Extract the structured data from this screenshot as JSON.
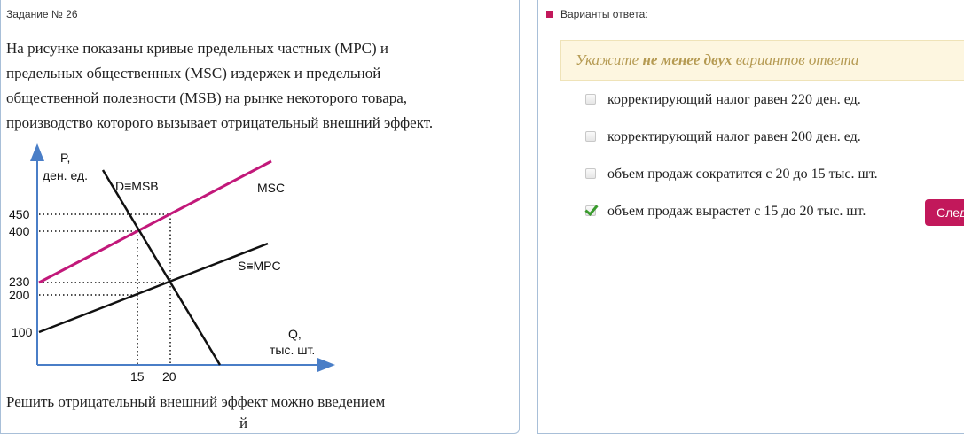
{
  "task": {
    "title": "Задание № 26"
  },
  "question": {
    "lines": [
      "На рисунке показаны кривые предельных частных (MPC) и",
      "предельных общественных (MSC) издержек и предельной",
      "общественной полезности (MSB) на рынке некоторого товара,",
      "производство которого вызывает отрицательный внешний эффект."
    ],
    "bottom": "Решить отрицательный внешний эффект можно введением",
    "bottom_cut": "й"
  },
  "graph": {
    "y_label_line1": "P,",
    "y_label_line2": "ден. ед.",
    "x_label_line1": "Q,",
    "x_label_line2": "тыс. шт.",
    "y_ticks": [
      "450",
      "400",
      "230",
      "200",
      "100"
    ],
    "x_ticks": [
      "15",
      "20"
    ],
    "curve_d": "D≡MSB",
    "curve_msc": "MSC",
    "curve_s": "S≡MPC"
  },
  "answers": {
    "heading": "Варианты ответа:",
    "hint_pre": "Укажите ",
    "hint_bold": "не менее двух",
    "hint_post": " вариантов ответа",
    "options": [
      {
        "label": "корректирующий налог равен 220 ден. ед.",
        "checked": false
      },
      {
        "label": "корректирующий налог равен 200 ден. ед.",
        "checked": false
      },
      {
        "label": "объем продаж сократится с 20 до 15 тыс. шт.",
        "checked": false
      },
      {
        "label": "объем продаж вырастет с 15 до 20 тыс. шт.",
        "checked": true
      }
    ],
    "next_label": "Следующий"
  },
  "colors": {
    "accent": "#c2185b",
    "axis": "#4a7ec7",
    "msc_line": "#c2187a",
    "check": "#3a9b2e"
  }
}
